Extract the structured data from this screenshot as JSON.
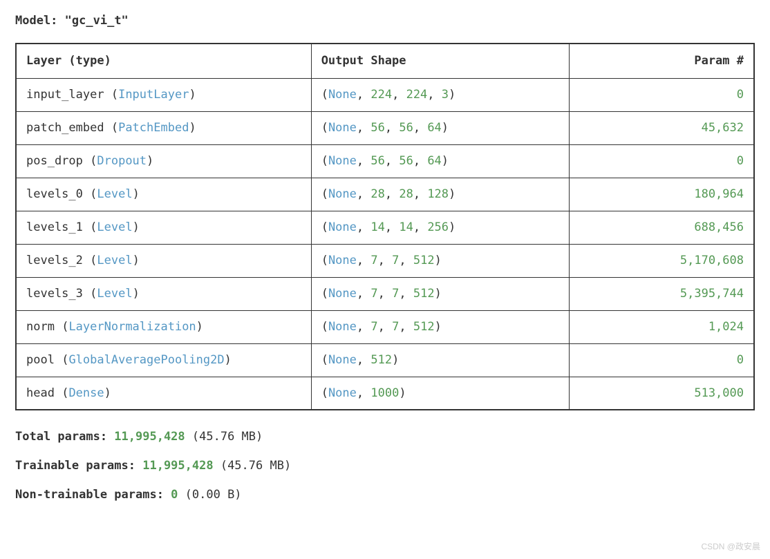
{
  "model": {
    "label": "Model:",
    "name": "\"gc_vi_t\""
  },
  "headers": {
    "layer": "Layer (type)",
    "shape": "Output Shape",
    "params": "Param #"
  },
  "rows": [
    {
      "name": "input_layer",
      "open": " (",
      "type": "InputLayer",
      "close": ")",
      "sopen": "(",
      "none": "None",
      "c1": ", ",
      "d1": "224",
      "c2": ", ",
      "d2": "224",
      "c3": ", ",
      "d3": "3",
      "sclose": ")",
      "param": "0"
    },
    {
      "name": "patch_embed",
      "open": " (",
      "type": "PatchEmbed",
      "close": ")",
      "sopen": "(",
      "none": "None",
      "c1": ", ",
      "d1": "56",
      "c2": ", ",
      "d2": "56",
      "c3": ", ",
      "d3": "64",
      "sclose": ")",
      "param": "45,632"
    },
    {
      "name": "pos_drop",
      "open": " (",
      "type": "Dropout",
      "close": ")",
      "sopen": "(",
      "none": "None",
      "c1": ", ",
      "d1": "56",
      "c2": ", ",
      "d2": "56",
      "c3": ", ",
      "d3": "64",
      "sclose": ")",
      "param": "0"
    },
    {
      "name": "levels_0",
      "open": " (",
      "type": "Level",
      "close": ")",
      "sopen": "(",
      "none": "None",
      "c1": ", ",
      "d1": "28",
      "c2": ", ",
      "d2": "28",
      "c3": ", ",
      "d3": "128",
      "sclose": ")",
      "param": "180,964"
    },
    {
      "name": "levels_1",
      "open": " (",
      "type": "Level",
      "close": ")",
      "sopen": "(",
      "none": "None",
      "c1": ", ",
      "d1": "14",
      "c2": ", ",
      "d2": "14",
      "c3": ", ",
      "d3": "256",
      "sclose": ")",
      "param": "688,456"
    },
    {
      "name": "levels_2",
      "open": " (",
      "type": "Level",
      "close": ")",
      "sopen": "(",
      "none": "None",
      "c1": ", ",
      "d1": "7",
      "c2": ", ",
      "d2": "7",
      "c3": ", ",
      "d3": "512",
      "sclose": ")",
      "param": "5,170,608"
    },
    {
      "name": "levels_3",
      "open": " (",
      "type": "Level",
      "close": ")",
      "sopen": "(",
      "none": "None",
      "c1": ", ",
      "d1": "7",
      "c2": ", ",
      "d2": "7",
      "c3": ", ",
      "d3": "512",
      "sclose": ")",
      "param": "5,395,744"
    },
    {
      "name": "norm",
      "open": " (",
      "type": "LayerNormalization",
      "close": ")",
      "sopen": "(",
      "none": "None",
      "c1": ", ",
      "d1": "7",
      "c2": ", ",
      "d2": "7",
      "c3": ", ",
      "d3": "512",
      "sclose": ")",
      "param": "1,024"
    },
    {
      "name": "pool",
      "open": " (",
      "type": "GlobalAveragePooling2D",
      "close": ")",
      "sopen": "(",
      "none": "None",
      "c1": ", ",
      "d1": "512",
      "c2": "",
      "d2": "",
      "c3": "",
      "d3": "",
      "sclose": ")",
      "param": "0"
    },
    {
      "name": "head",
      "open": " (",
      "type": "Dense",
      "close": ")",
      "sopen": "(",
      "none": "None",
      "c1": ", ",
      "d1": "1000",
      "c2": "",
      "d2": "",
      "c3": "",
      "d3": "",
      "sclose": ")",
      "param": "513,000"
    }
  ],
  "summary": {
    "total_label": "Total params: ",
    "total_val": "11,995,428",
    "total_size": " (45.76 MB)",
    "trainable_label": "Trainable params: ",
    "trainable_val": "11,995,428",
    "trainable_size": " (45.76 MB)",
    "nontrainable_label": "Non-trainable params: ",
    "nontrainable_val": "0",
    "nontrainable_size": " (0.00 B)"
  },
  "watermark": "CSDN @政安晨"
}
